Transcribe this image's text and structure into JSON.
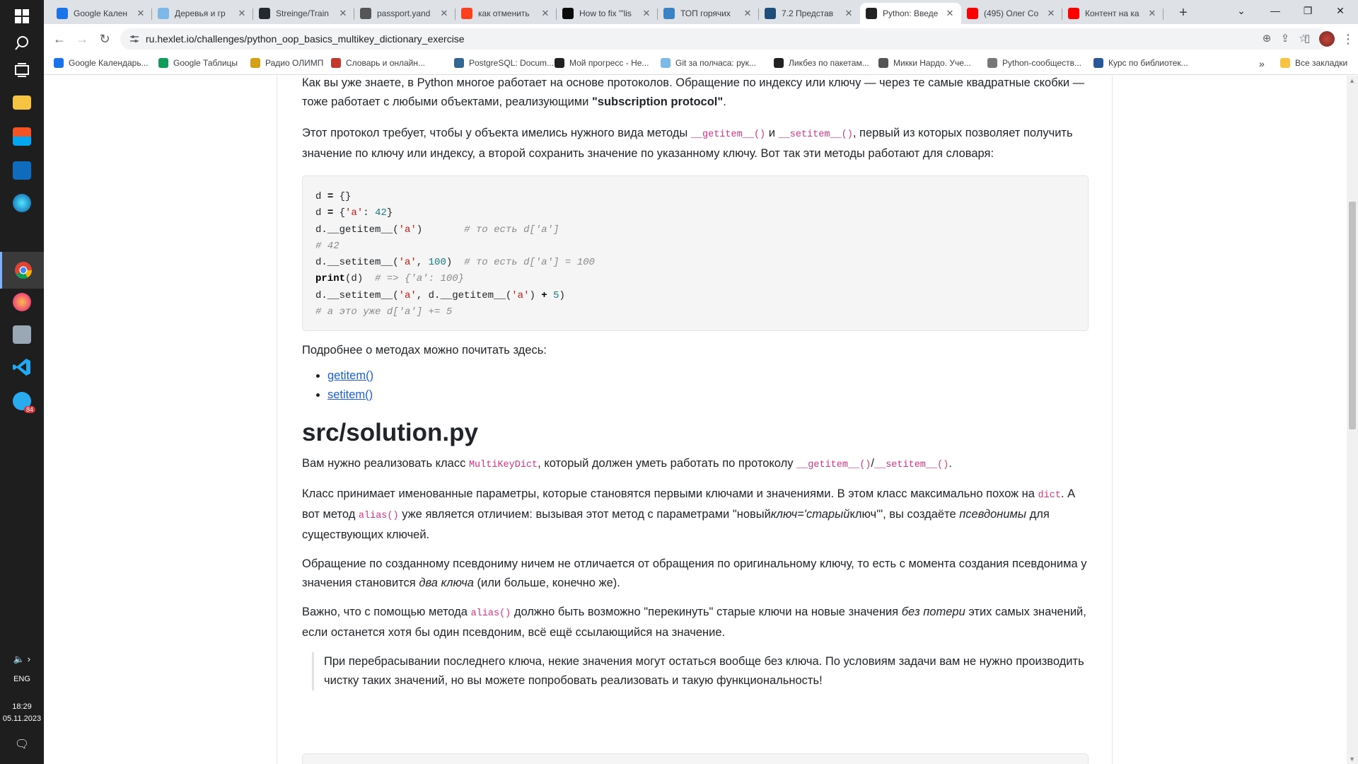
{
  "taskbar": {
    "icons": [
      "windows-start",
      "search",
      "task-view",
      "file-explorer",
      "microsoft-store",
      "mail",
      "edge",
      "chrome",
      "firefox",
      "disk-manager",
      "vscode",
      "telegram"
    ],
    "telegram_badge": "84",
    "language": "ENG",
    "time": "18:29",
    "date": "05.11.2023"
  },
  "tabs": [
    {
      "title": "Google Кален",
      "color": "#1a73e8"
    },
    {
      "title": "Деревья и гр",
      "color": "#7cb9e8"
    },
    {
      "title": "Streinge/Train",
      "color": "#24292f"
    },
    {
      "title": "passport.yand",
      "color": "#555555"
    },
    {
      "title": "как отменить",
      "color": "#fc3f1d"
    },
    {
      "title": "How to fix \"'lis",
      "color": "#0a0a0a"
    },
    {
      "title": "ТОП горячих",
      "color": "#3b82c4"
    },
    {
      "title": "7.2 Представ",
      "color": "#1e4e79"
    },
    {
      "title": "Python: Введе",
      "color": "#222222"
    },
    {
      "title": "(495) Олег Со",
      "color": "#ff0000"
    },
    {
      "title": "Контент на ка",
      "color": "#ff0000"
    }
  ],
  "active_tab_index": 8,
  "url": "ru.hexlet.io/challenges/python_oop_basics_multikey_dictionary_exercise",
  "bookmarks": [
    {
      "label": "Google Календарь...",
      "color": "#1a73e8"
    },
    {
      "label": "Google Таблицы",
      "color": "#0f9d58"
    },
    {
      "label": "Радио ОЛИМП",
      "color": "#d4a017"
    },
    {
      "label": "Словарь и онлайн...",
      "color": "#c0392b"
    },
    {
      "label": "PostgreSQL: Docum...",
      "color": "#336791"
    },
    {
      "label": "Мой прогресс - Не...",
      "color": "#222222"
    },
    {
      "label": "Git за полчаса: рук...",
      "color": "#7cb9e8"
    },
    {
      "label": "Ликбез по пакетам...",
      "color": "#222222"
    },
    {
      "label": "Микки Нардо. Уче...",
      "color": "#555555"
    },
    {
      "label": "Python-сообществ...",
      "color": "#777777"
    },
    {
      "label": "Курс по библиотек...",
      "color": "#2b5797"
    }
  ],
  "bookmarks_overflow": "»",
  "all_bookmarks": "Все закладки",
  "article": {
    "p1_a": "Как вы уже знаете, в Python многое работает на основе протоколов. Обращение по индексу или ключу — через те самые квадратные скобки — тоже работает с любыми объектами, реализующими ",
    "p1_b": "\"subscription protocol\"",
    "p1_c": ".",
    "p2_a": "Этот протокол требует, чтобы у объекта имелись нужного вида методы ",
    "p2_code1": "__getitem__()",
    "p2_b": " и ",
    "p2_code2": "__setitem__()",
    "p2_c": ", первый из которых позволяет получить значение по ключу или индексу, а второй сохранить значение по указанному ключу. Вот так эти методы работают для словаря:",
    "code": {
      "l1a": "d ",
      "l1op": "=",
      "l1b": " {}",
      "l2a": "d ",
      "l2op": "=",
      "l2b": " {",
      "l2s": "'a'",
      "l2c": ": ",
      "l2n": "42",
      "l2d": "}",
      "l3a": "d.__getitem__(",
      "l3s": "'a'",
      "l3b": ")       ",
      "l3cm": "# то есть d['a']",
      "l4cm": "# 42",
      "l5a": "d.__setitem__(",
      "l5s": "'a'",
      "l5b": ", ",
      "l5n": "100",
      "l5c": ")  ",
      "l5cm": "# то есть d['a'] = 100",
      "l6kw": "print",
      "l6a": "(d)  ",
      "l6cm": "# => {'a': 100}",
      "l7a": "d.__setitem__(",
      "l7s": "'a'",
      "l7b": ", d.__getitem__(",
      "l7s2": "'a'",
      "l7c": ") ",
      "l7op": "+",
      "l7d": " ",
      "l7n": "5",
      "l7e": ")",
      "l8cm": "# а это уже d['a'] += 5"
    },
    "p3": "Подробнее о методах можно почитать здесь:",
    "link1": "getitem()",
    "link2": "setitem()",
    "heading": "src/solution.py",
    "p4_a": "Вам нужно реализовать класс ",
    "p4_code1": "MultiKeyDict",
    "p4_b": ", который должен уметь работать по протоколу ",
    "p4_code2": "__getitem__()",
    "p4_c": "/",
    "p4_code3": "__setitem__()",
    "p4_d": ".",
    "p5_a": "Класс принимает именованные параметры, которые становятся первыми ключами и значениями. В этом класс максимально похож на ",
    "p5_code1": "dict",
    "p5_b": ". А вот метод ",
    "p5_code2": "alias()",
    "p5_c": " уже является отличием: вызывая этот метод с параметрами \"новый",
    "p5_i1": "ключ='старый",
    "p5_d": "ключ'\", вы создаёте ",
    "p5_i2": "псевдонимы",
    "p5_e": " для существующих ключей.",
    "p6_a": "Обращение по созданному псевдониму ничем не отличается от обращения по оригинальному ключу, то есть с момента создания псевдонима у значения становится ",
    "p6_i": "два ключа",
    "p6_b": " (или больше, конечно же).",
    "p7_a": "Важно, что с помощью метода ",
    "p7_code": "alias()",
    "p7_b": " должно быть возможно \"перекинуть\" старые ключи на новые значения ",
    "p7_i": "без потери",
    "p7_c": " этих самых значений, если останется хотя бы один псевдоним, всё ещё ссылающийся на значение.",
    "quote": "При перебрасывании последнего ключа, некие значения могут остаться вообще без ключа. По условиям задачи вам не нужно производить чистку таких значений, но вы можете попробовать реализовать и такую функциональность!"
  }
}
